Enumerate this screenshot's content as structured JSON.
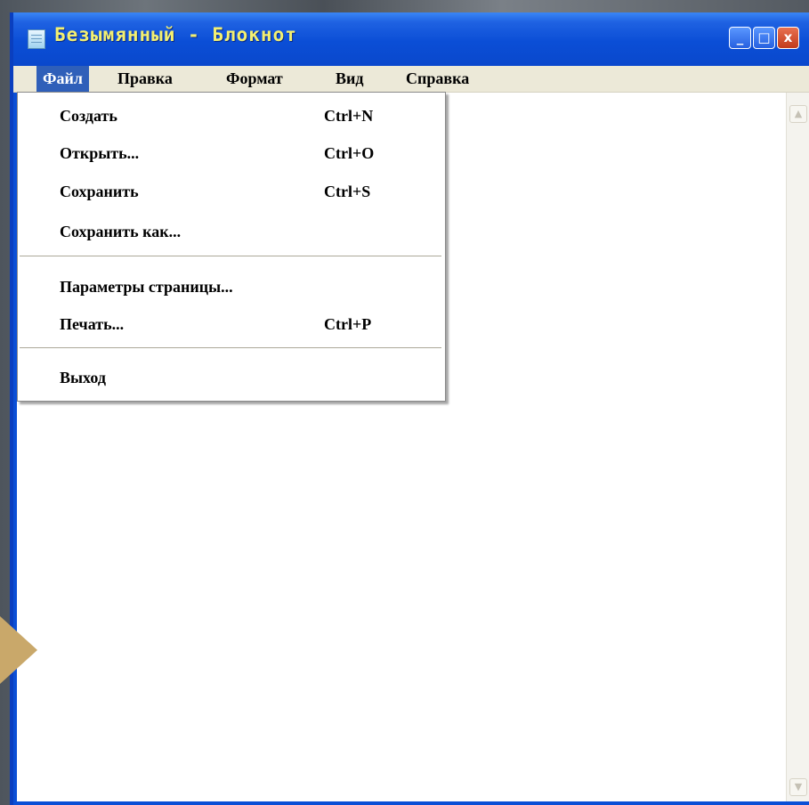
{
  "window": {
    "title": "Безымянный  -  Блокнот",
    "controls": {
      "minimize": "_",
      "maximize": "□",
      "close": "x"
    }
  },
  "menubar": {
    "items": [
      "Файл",
      "Правка",
      "Формат",
      "Вид",
      "Справка"
    ],
    "active": "Файл"
  },
  "file_menu": {
    "items": [
      {
        "label": "Создать",
        "shortcut": "Ctrl+N"
      },
      {
        "label": "Открыть...",
        "shortcut": "Ctrl+O"
      },
      {
        "label": "Сохранить",
        "shortcut": "Ctrl+S"
      },
      {
        "label": "Сохранить как...",
        "shortcut": ""
      },
      {
        "label": "Параметры страницы...",
        "shortcut": ""
      },
      {
        "label": "Печать...",
        "shortcut": "Ctrl+P"
      },
      {
        "label": "Выход",
        "shortcut": ""
      }
    ]
  },
  "scrollbar": {
    "up_icon": "▲",
    "down_icon": "▼"
  },
  "colors": {
    "title_text": "#f3f071",
    "titlebar": "#0b4ed6",
    "menu_highlight": "#2f5fb9",
    "arrow": "#c9a86a"
  }
}
